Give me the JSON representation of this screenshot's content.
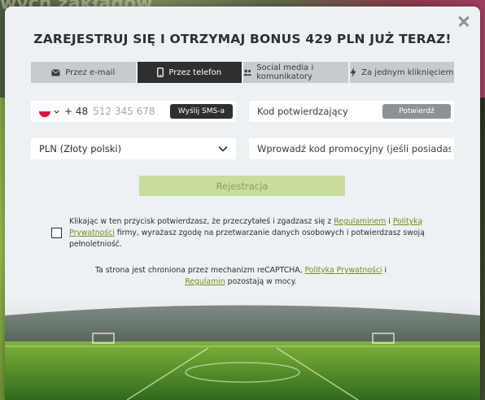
{
  "background": {
    "title": "wych zakładów"
  },
  "modal": {
    "title": "ZAREJESTRUJ SIĘ I OTRZYMAJ BONUS 429 PLN JUŻ TERAZ!",
    "tabs": [
      {
        "label": "Przez e-mail",
        "icon": "envelope-icon"
      },
      {
        "label": "Przez telefon",
        "icon": "phone-icon",
        "active": true
      },
      {
        "label": "Social media i komunikatory",
        "icon": "users-icon"
      },
      {
        "label": "Za jednym kliknięciem",
        "icon": "lightning-icon"
      }
    ],
    "phone": {
      "prefix": "+ 48",
      "placeholder": "512 345 678",
      "sms_button": "Wyślij SMS-a",
      "country_flag": "pl-flag-icon"
    },
    "code": {
      "placeholder": "Kod potwierdzający",
      "confirm_button": "Potwierdź"
    },
    "currency": {
      "value": "PLN (Złoty polski)"
    },
    "promo": {
      "placeholder": "Wprowadź kod promocyjny (jeśli posiadasz)"
    },
    "register_button": "Rejestracja",
    "consent": {
      "part1": "Klikając w ten przycisk potwierdzasz, że przeczytałeś i zgadzasz się z ",
      "link1": "Regulaminem",
      "part2": " i ",
      "link2": "Polityką Prywatności",
      "part3": " firmy, wyrażasz zgodę na przetwarzanie danych osobowych i potwierdzasz swoją pełnoletniość."
    },
    "recaptcha": {
      "part1": "Ta strona jest chroniona przez mechanizm reCAPTCHA, ",
      "link1": "Polityka Prywatności",
      "part2": " i ",
      "link2": "Regulamin",
      "part3": " pozostają w mocy."
    }
  },
  "colors": {
    "accent_link": "#6c8f1d",
    "register_bg": "#c8dc9c",
    "active_tab": "#2d2f31",
    "tab_bg": "#c7cbcf"
  }
}
